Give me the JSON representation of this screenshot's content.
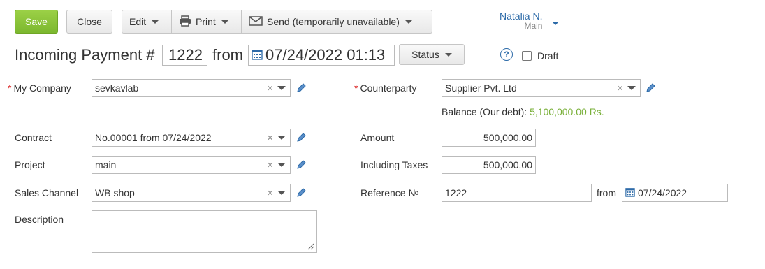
{
  "toolbar": {
    "save_label": "Save",
    "close_label": "Close",
    "edit_label": "Edit",
    "print_label": "Print",
    "send_label": "Send (temporarily unavailable)"
  },
  "user": {
    "name": "Natalia N.",
    "sub": "Main"
  },
  "doc": {
    "title": "Incoming Payment #",
    "number": "1222",
    "from_label": "from",
    "datetime": "07/24/2022 01:13",
    "status_label": "Status",
    "draft_label": "Draft",
    "help": "?"
  },
  "form": {
    "my_company_label": "My Company",
    "my_company_value": "sevkavlab",
    "contract_label": "Contract",
    "contract_value": "No.00001 from 07/24/2022",
    "project_label": "Project",
    "project_value": "main",
    "sales_channel_label": "Sales Channel",
    "sales_channel_value": "WB shop",
    "description_label": "Description",
    "counterparty_label": "Counterparty",
    "counterparty_value": "Supplier Pvt. Ltd",
    "balance_label": "Balance (Our debt):",
    "balance_value": "5,100,000.00 Rs.",
    "amount_label": "Amount",
    "amount_value": "500,000.00",
    "taxes_label": "Including Taxes",
    "taxes_value": "500,000.00",
    "reference_label": "Reference №",
    "reference_value": "1222",
    "ref_from_label": "from",
    "ref_date": "07/24/2022",
    "required_mark": "*",
    "clear_glyph": "×"
  },
  "colors": {
    "accent_green": "#7cb82f",
    "link_blue": "#2c6aa8",
    "balance_green": "#7ab03a"
  }
}
